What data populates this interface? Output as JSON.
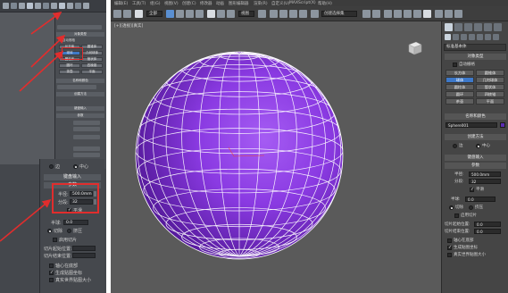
{
  "left_panel": {
    "zoom": {
      "header": "键盘输入",
      "params_header": "参数",
      "radius_label": "半径:",
      "radius_value": "500.0mm",
      "segments_label": "分段:",
      "segments_value": "32",
      "smooth_label": "平滑",
      "hemisphere_label": "半球:",
      "hemisphere_value": "0.0",
      "chop_label": "切除",
      "squash_label": "挤压",
      "slice_on_label": "启用切片",
      "slice_from_label": "切片起始位置:",
      "slice_to_label": "切片结束位置:",
      "base_to_pivot_label": "轴心在底部",
      "gen_coords_label": "生成贴图坐标",
      "real_world_label": "真实世界贴图大小",
      "edge_label": "边",
      "center_label": "中心"
    },
    "mini_panel": {
      "object_type": "对象类型",
      "autogrid": "自动栅格",
      "buttons": [
        "长方体",
        "圆锥体",
        "球体",
        "几何球体",
        "圆柱体",
        "管状体",
        "圆环",
        "四棱锥",
        "茶壶",
        "平面"
      ],
      "name_color": "名称和颜色",
      "creation_method": "创建方法",
      "keyboard_entry": "键盘输入",
      "params": "参数"
    }
  },
  "main": {
    "menu": [
      "编辑(E)",
      "工具(T)",
      "组(G)",
      "视图(V)",
      "创建(C)",
      "修改器",
      "动画",
      "图形编辑器",
      "渲染(R)",
      "自定义(U)",
      "MAXScript(X)",
      "帮助(H)"
    ],
    "toolbar": {
      "filter_dropdown": "全部",
      "view_dropdown": "视图",
      "selection_set": "创建选择集"
    },
    "viewport_label": "[+][透视][真实]",
    "command_panel": {
      "category_dropdown": "标准基本体",
      "object_type_header": "对象类型",
      "autogrid_label": "自动栅格",
      "buttons": [
        "长方体",
        "圆锥体",
        "球体",
        "几何球体",
        "圆柱体",
        "管状体",
        "圆环",
        "四棱锥",
        "茶壶",
        "平面"
      ],
      "selected_button": "球体",
      "name_color_header": "名称和颜色",
      "object_name": "Sphere001",
      "object_color": "#5a2db0",
      "creation_method_header": "创建方法",
      "edge_label": "边",
      "center_label": "中心",
      "keyboard_entry_header": "键盘输入",
      "params_header": "参数",
      "radius_label": "半径:",
      "radius_value": "500.0mm",
      "segments_label": "分段:",
      "segments_value": "32",
      "smooth_label": "平滑",
      "hemisphere_label": "半球:",
      "hemisphere_value": "0.0",
      "chop_label": "切除",
      "squash_label": "挤压",
      "slice_on_label": "启用切片",
      "slice_from_label": "切片起始位置:",
      "slice_from_value": "0.0",
      "slice_to_label": "切片结束位置:",
      "slice_to_value": "0.0",
      "base_to_pivot_label": "轴心在底部",
      "gen_coords_label": "生成贴图坐标",
      "real_world_label": "真实世界贴图大小"
    }
  },
  "colors": {
    "sphere": "#7b2fd6",
    "annotation_red": "#e12d2d",
    "selected_button": "#3d78c9"
  }
}
